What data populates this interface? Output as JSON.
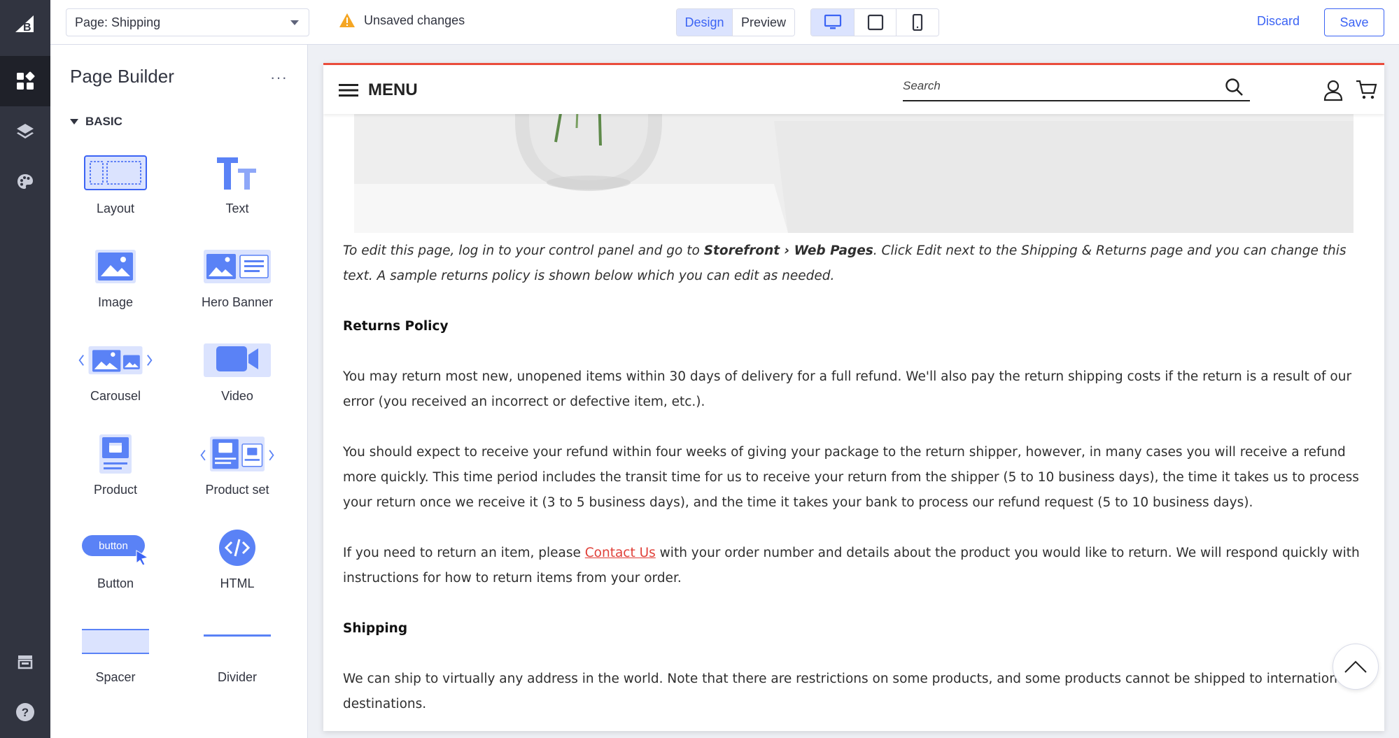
{
  "topbar": {
    "page_select_value": "Page: Shipping",
    "unsaved_label": "Unsaved changes",
    "mode_tabs": [
      "Design",
      "Preview"
    ],
    "discard_label": "Discard",
    "save_label": "Save",
    "accent_color": "#3c64f4",
    "warning_color": "#f5a623"
  },
  "rail": {
    "items": [
      "logo-icon",
      "widgets-icon",
      "layers-icon",
      "palette-icon",
      "storefront-icon",
      "help-icon"
    ]
  },
  "panel": {
    "title": "Page Builder",
    "more_label": "···",
    "section_label": "BASIC",
    "widgets": [
      "Layout",
      "Text",
      "Image",
      "Hero Banner",
      "Carousel",
      "Video",
      "Product",
      "Product set",
      "Button",
      "HTML",
      "Spacer",
      "Divider"
    ],
    "button_widget_sample": "button"
  },
  "storefront": {
    "menu_label": "MENU",
    "search_placeholder": "Search",
    "intro_pre": "To edit this page, log in to your control panel and go to ",
    "intro_bold": "Storefront › Web Pages",
    "intro_post": ". Click Edit next to the Shipping & Returns page and you can change this text. A sample returns policy is shown below which you can edit as needed.",
    "returns_heading": "Returns Policy",
    "returns_p1": "You may return most new, unopened items within 30 days of delivery for a full refund. We'll also pay the return shipping costs if the return is a result of our error (you received an incorrect or defective item, etc.).",
    "returns_p2": "You should expect to receive your refund within four weeks of giving your package to the return shipper, however, in many cases you will receive a refund more quickly. This time period includes the transit time for us to receive your return from the shipper (5 to 10 business days), the time it takes us to process your return once we receive it (3 to 5 business days), and the time it takes your bank to process our refund request (5 to 10 business days).",
    "returns_p3_pre": "If you need to return an item, please ",
    "contact_link": "Contact Us",
    "returns_p3_post": " with your order number and details about the product you would like to return. We will respond quickly with instructions for how to return items from your order.",
    "shipping_heading": "Shipping",
    "shipping_p1": "We can ship to virtually any address in the world. Note that there are restrictions on some products, and some products cannot be shipped to international destinations.",
    "top_border_color": "#ea4c3b",
    "link_color": "#e0413a"
  }
}
